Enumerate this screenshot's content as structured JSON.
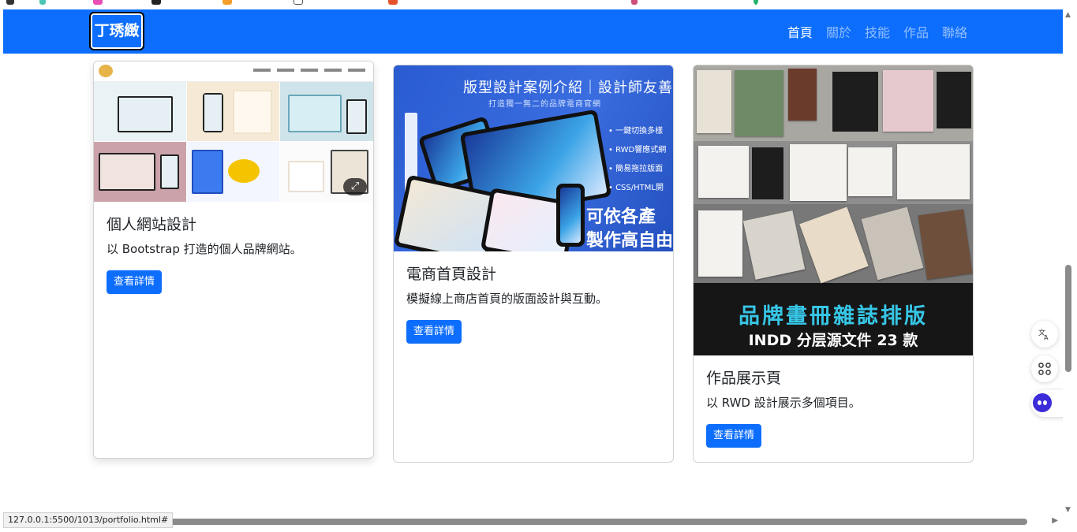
{
  "brand": "丁琇緻",
  "nav": {
    "links": [
      "首頁",
      "關於",
      "技能",
      "作品",
      "聯絡"
    ],
    "active_index": 0
  },
  "cards": [
    {
      "title": "個人網站設計",
      "text": "以 Bootstrap 打造的個人品牌網站。",
      "button": "查看詳情"
    },
    {
      "title": "電商首頁設計",
      "text": "模擬線上商店首頁的版面設計與互動。",
      "button": "查看詳情",
      "image_text": {
        "headline": "版型設計案例介紹｜設計師友善",
        "sub": "打造獨一無二的品牌電商官網",
        "bullets": [
          "• 一鍵切換多樣",
          "• RWD響應式網",
          "• 簡易拖拉版面",
          "• CSS/HTML開"
        ],
        "big_line1": "可依各產",
        "big_line2": "製作高自由"
      }
    },
    {
      "title": "作品展示頁",
      "text": "以 RWD 設計展示多個項目。",
      "button": "查看詳情",
      "image_text": {
        "title_cn": "品牌畫冊雜誌排版",
        "title_en": "INDD 分层源文件 23 款"
      }
    }
  ],
  "side_widgets": {
    "translate_icon": "translate-icon",
    "apps_icon": "apps-grid-icon",
    "assistant_icon": "assistant-robot-icon"
  },
  "status_url": "127.0.0.1:5500/1013/portfolio.html#",
  "colors": {
    "primary": "#0d6efd",
    "card_border": "#d9d9d9",
    "thumb2_bg": "#2a5bd1",
    "thumb3_title": "#37c6e6"
  }
}
